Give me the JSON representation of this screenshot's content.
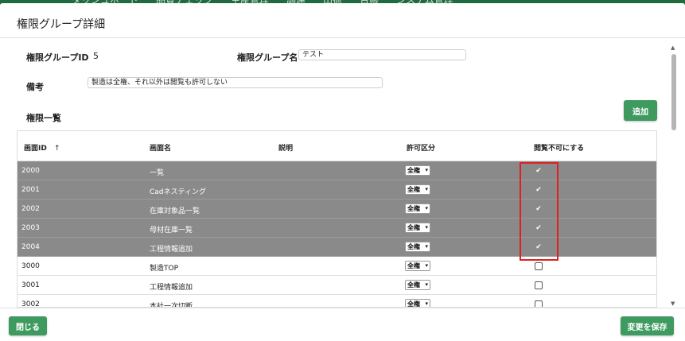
{
  "background_nav": {
    "items": [
      "ダッシュボード",
      "品質チェック",
      "生産管理",
      "調達",
      "出荷",
      "台帳",
      "システム管理"
    ]
  },
  "modal": {
    "title": "権限グループ詳細"
  },
  "form": {
    "group_id_label": "権限グループID",
    "group_id_value": "5",
    "group_name_label": "権限グループ名",
    "group_name_value": "テスト",
    "remarks_label": "備考",
    "remarks_value": "製造は全権、それ以外は閲覧も許可しない",
    "permissions_label": "権限一覧",
    "add_button": "追加"
  },
  "table": {
    "headers": {
      "screen_id": "画面ID",
      "sort_icon": "↑",
      "screen_name": "画面名",
      "description": "説明",
      "permission_type": "許可区分",
      "hide": "閲覧不可にする"
    },
    "rows": [
      {
        "id": "2000",
        "name": "一覧",
        "description": "",
        "permission": "全権",
        "hidden": true,
        "selected": true
      },
      {
        "id": "2001",
        "name": "Cadネスティング",
        "description": "",
        "permission": "全権",
        "hidden": true,
        "selected": true
      },
      {
        "id": "2002",
        "name": "在庫対象品一覧",
        "description": "",
        "permission": "全権",
        "hidden": true,
        "selected": true
      },
      {
        "id": "2003",
        "name": "母材在庫一覧",
        "description": "",
        "permission": "全権",
        "hidden": true,
        "selected": true
      },
      {
        "id": "2004",
        "name": "工程情報追加",
        "description": "",
        "permission": "全権",
        "hidden": true,
        "selected": true
      },
      {
        "id": "3000",
        "name": "製造TOP",
        "description": "",
        "permission": "全権",
        "hidden": false,
        "selected": false
      },
      {
        "id": "3001",
        "name": "工程情報追加",
        "description": "",
        "permission": "全権",
        "hidden": false,
        "selected": false
      },
      {
        "id": "3002",
        "name": "本社一次切断",
        "description": "",
        "permission": "全権",
        "hidden": false,
        "selected": false
      }
    ]
  },
  "footer": {
    "close_button": "閉じる",
    "save_button": "変更を保存"
  },
  "colors": {
    "primary_green": "#3f9a5f",
    "selected_row": "#8a8a8a",
    "highlight_red": "#e02020"
  }
}
